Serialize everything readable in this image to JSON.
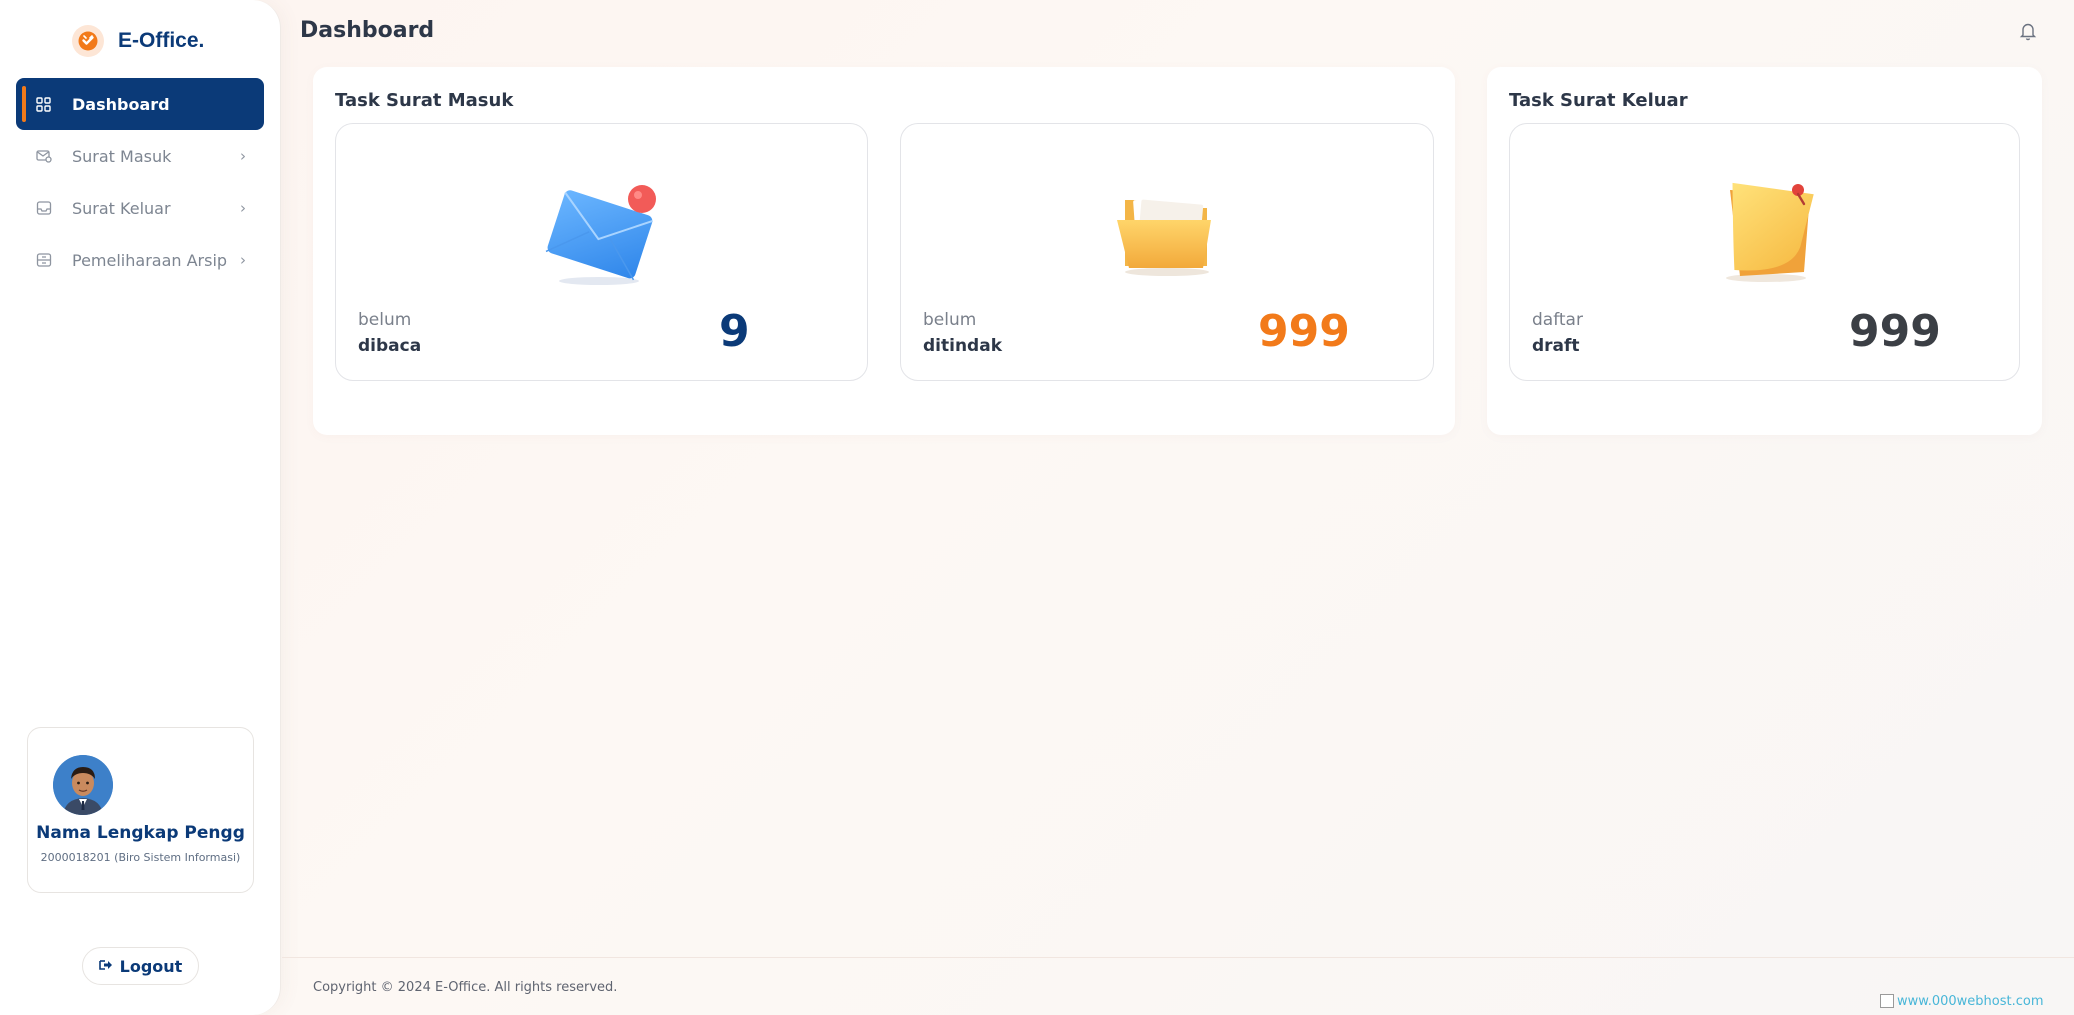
{
  "brand": {
    "name": "E-Office."
  },
  "sidebar": {
    "items": [
      {
        "label": "Dashboard",
        "active": true,
        "icon": "grid-icon"
      },
      {
        "label": "Surat Masuk",
        "active": false,
        "icon": "mail-in-icon"
      },
      {
        "label": "Surat Keluar",
        "active": false,
        "icon": "inbox-tray-icon"
      },
      {
        "label": "Pemeliharaan Arsip",
        "active": false,
        "icon": "archive-box-icon"
      }
    ]
  },
  "profile": {
    "name": "Nama Lengkap Pengg",
    "meta": "2000018201 (Biro Sistem Informasi)"
  },
  "logout_label": "Logout",
  "header": {
    "title": "Dashboard"
  },
  "panels": {
    "masuk": {
      "title": "Task Surat Masuk",
      "cards": [
        {
          "label_top": "belum",
          "label_bottom": "dibaca",
          "count": "9",
          "color": "#0b3a78",
          "icon": "envelope-icon"
        },
        {
          "label_top": "belum",
          "label_bottom": "ditindak",
          "count": "999",
          "color": "#f27a1a",
          "icon": "folder-icon"
        }
      ]
    },
    "keluar": {
      "title": "Task Surat Keluar",
      "cards": [
        {
          "label_top": "daftar",
          "label_bottom": "draft",
          "count": "999",
          "color": "#3b3f45",
          "icon": "sticky-note-icon"
        }
      ]
    }
  },
  "footer": {
    "copyright": "Copyright © 2024 E-Office. All rights reserved.",
    "watermark": "www.000webhost.com"
  },
  "colors": {
    "primary": "#0b3a78",
    "accent": "#f27a1a",
    "neutral_count": "#3b3f45"
  }
}
